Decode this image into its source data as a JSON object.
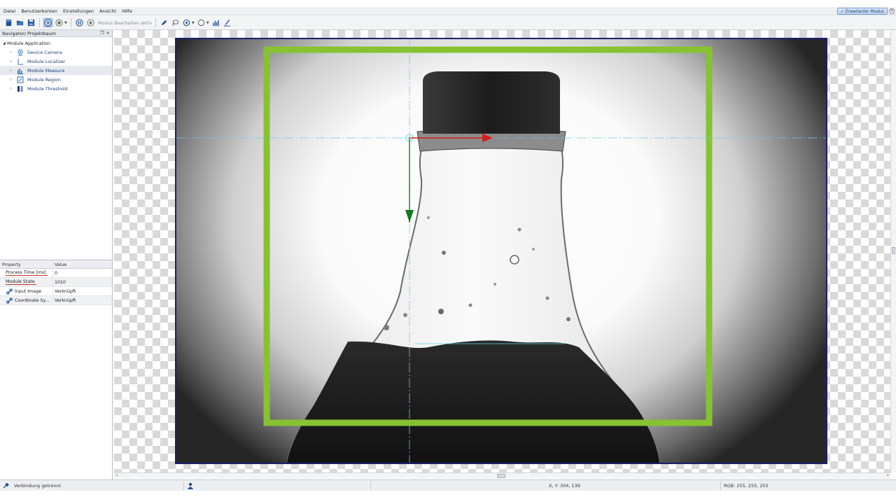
{
  "menu": {
    "items": [
      "Datei",
      "Benutzerkonten",
      "Einstellungen",
      "Ansicht",
      "Hilfe"
    ],
    "mode_button": "Erweiterter Modus"
  },
  "toolbar": {
    "edit_mode_label": "Modus Bearbeiten aktiv",
    "icons": [
      "new-project-icon",
      "open-folder-icon",
      "save-icon",
      "run-icon",
      "record-icon",
      "pause-icon",
      "edit-mode-icon",
      "pen-icon",
      "lasso-icon",
      "target-icon",
      "circle-icon",
      "histogram-icon",
      "brush-icon"
    ]
  },
  "navigator": {
    "title": "Navigator/ Projektbaum",
    "root": "Module Application",
    "items": [
      {
        "label": "Device Camera",
        "icon": "camera-icon"
      },
      {
        "label": "Module Localizer",
        "icon": "localizer-icon"
      },
      {
        "label": "Module Measure",
        "icon": "measure-icon"
      },
      {
        "label": "Module Region",
        "icon": "region-icon"
      },
      {
        "label": "Module Threshold",
        "icon": "threshold-icon"
      }
    ],
    "selected_index": 2
  },
  "properties": {
    "headers": {
      "property": "Property",
      "value": "Value"
    },
    "rows": [
      {
        "property": "Process Time [ms]",
        "value": "0"
      },
      {
        "property": "Module State",
        "value": "1010"
      },
      {
        "property": "Input Image",
        "value": "Verknüpft"
      },
      {
        "property": "Coordinate Sy...",
        "value": "Verknüpft"
      }
    ]
  },
  "status": {
    "connection": "Verbindung getrennt",
    "coords": "X, Y: 304, 139",
    "rgb": "RGB: 255, 255, 255"
  },
  "colors": {
    "roi_green": "#86c232",
    "crosshair": "#5fd3e0",
    "arrow_red": "#d81b1b",
    "arrow_green": "#0f7a1c",
    "image_border": "#1c1f6e"
  }
}
